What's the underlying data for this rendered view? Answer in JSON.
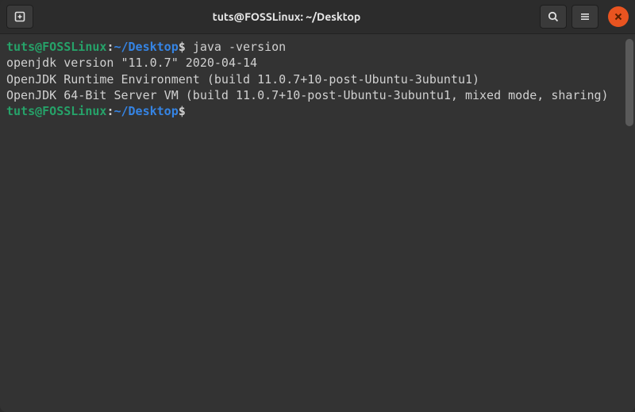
{
  "titlebar": {
    "title": "tuts@FOSSLinux: ~/Desktop"
  },
  "prompt": {
    "user": "tuts",
    "at": "@",
    "host": "FOSSLinux",
    "colon": ":",
    "path": "~/Desktop",
    "dollar": "$"
  },
  "terminal": {
    "command1": "java -version",
    "output_line1": "openjdk version \"11.0.7\" 2020-04-14",
    "output_line2": "OpenJDK Runtime Environment (build 11.0.7+10-post-Ubuntu-3ubuntu1)",
    "output_line3": "OpenJDK 64-Bit Server VM (build 11.0.7+10-post-Ubuntu-3ubuntu1, mixed mode, sharing)",
    "command2": ""
  }
}
